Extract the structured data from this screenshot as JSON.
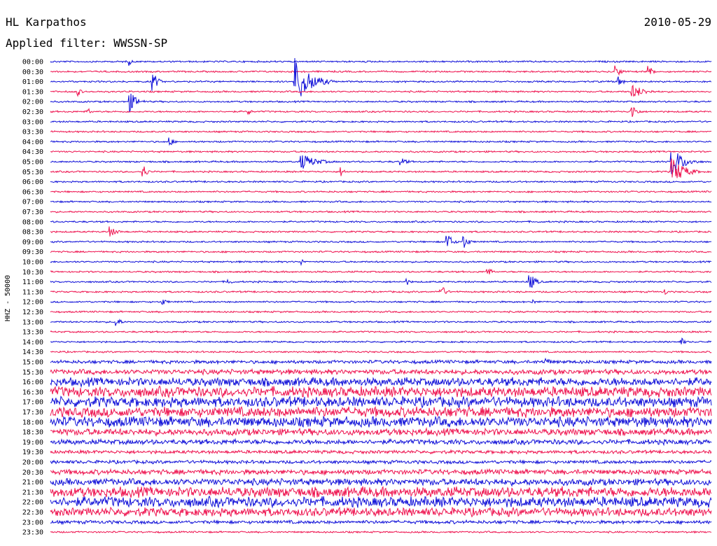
{
  "header": {
    "station": "HL Karpathos",
    "date": "2010-05-29",
    "filter_label": "Applied filter: WWSSN-SP"
  },
  "chart_data": {
    "type": "line",
    "title": "HL Karpathos",
    "ylabel": "HHZ - 50000",
    "colors": [
      "#1010d8",
      "#ee1450"
    ],
    "row_labels": [
      "00:00",
      "00:30",
      "01:00",
      "01:30",
      "02:00",
      "02:30",
      "03:00",
      "03:30",
      "04:00",
      "04:30",
      "05:00",
      "05:30",
      "06:00",
      "06:30",
      "07:00",
      "07:30",
      "08:00",
      "08:30",
      "09:00",
      "09:30",
      "10:00",
      "10:30",
      "11:00",
      "11:30",
      "12:00",
      "12:30",
      "13:00",
      "13:30",
      "14:00",
      "14:30",
      "15:00",
      "15:30",
      "16:00",
      "16:30",
      "17:00",
      "17:30",
      "18:00",
      "18:30",
      "19:00",
      "19:30",
      "20:00",
      "20:30",
      "21:00",
      "21:30",
      "22:00",
      "22:30",
      "23:00",
      "23:30"
    ],
    "noise_level": [
      1,
      1,
      1,
      1,
      1,
      1,
      1,
      1,
      1,
      1,
      1,
      1,
      1,
      1,
      1,
      1,
      1,
      1,
      1,
      1,
      1,
      1,
      1,
      1,
      1,
      1,
      1,
      1,
      1,
      1,
      2,
      3,
      5,
      6,
      6,
      6,
      6,
      4,
      3,
      2,
      2,
      3,
      4,
      6,
      6,
      5,
      2,
      1
    ],
    "events": [
      {
        "row": 0,
        "x": 0.12,
        "amp": 1,
        "dur": 0.01
      },
      {
        "row": 1,
        "x": 0.855,
        "amp": 1.6,
        "dur": 0.02
      },
      {
        "row": 1,
        "x": 0.905,
        "amp": 1.5,
        "dur": 0.02
      },
      {
        "row": 2,
        "x": 0.155,
        "amp": 2.5,
        "dur": 0.02
      },
      {
        "row": 2,
        "x": 0.37,
        "amp": 6,
        "dur": 0.06
      },
      {
        "row": 2,
        "x": 0.86,
        "amp": 1.5,
        "dur": 0.02
      },
      {
        "row": 3,
        "x": 0.04,
        "amp": 1.5,
        "dur": 0.015
      },
      {
        "row": 3,
        "x": 0.88,
        "amp": 1.8,
        "dur": 0.05
      },
      {
        "row": 4,
        "x": 0.12,
        "amp": 2.5,
        "dur": 0.03
      },
      {
        "row": 5,
        "x": 0.058,
        "amp": 1,
        "dur": 0.01
      },
      {
        "row": 5,
        "x": 0.3,
        "amp": 1,
        "dur": 0.01
      },
      {
        "row": 5,
        "x": 0.88,
        "amp": 2,
        "dur": 0.02
      },
      {
        "row": 8,
        "x": 0.18,
        "amp": 1.5,
        "dur": 0.015
      },
      {
        "row": 10,
        "x": 0.38,
        "amp": 2,
        "dur": 0.06
      },
      {
        "row": 10,
        "x": 0.53,
        "amp": 1,
        "dur": 0.03
      },
      {
        "row": 10,
        "x": 0.94,
        "amp": 3.5,
        "dur": 0.05
      },
      {
        "row": 11,
        "x": 0.14,
        "amp": 2.2,
        "dur": 0.015
      },
      {
        "row": 11,
        "x": 0.44,
        "amp": 1.2,
        "dur": 0.015
      },
      {
        "row": 11,
        "x": 0.94,
        "amp": 3.5,
        "dur": 0.05
      },
      {
        "row": 17,
        "x": 0.09,
        "amp": 1.3,
        "dur": 0.03
      },
      {
        "row": 18,
        "x": 0.6,
        "amp": 2.5,
        "dur": 0.02
      },
      {
        "row": 18,
        "x": 0.625,
        "amp": 1.8,
        "dur": 0.02
      },
      {
        "row": 20,
        "x": 0.38,
        "amp": 1,
        "dur": 0.01
      },
      {
        "row": 21,
        "x": 0.66,
        "amp": 1.5,
        "dur": 0.02
      },
      {
        "row": 22,
        "x": 0.27,
        "amp": 0.8,
        "dur": 0.015
      },
      {
        "row": 22,
        "x": 0.54,
        "amp": 0.8,
        "dur": 0.015
      },
      {
        "row": 22,
        "x": 0.725,
        "amp": 2.2,
        "dur": 0.025
      },
      {
        "row": 23,
        "x": 0.59,
        "amp": 2,
        "dur": 0.02
      },
      {
        "row": 23,
        "x": 0.93,
        "amp": 1,
        "dur": 0.01
      },
      {
        "row": 24,
        "x": 0.17,
        "amp": 0.8,
        "dur": 0.02
      },
      {
        "row": 24,
        "x": 0.73,
        "amp": 0.8,
        "dur": 0.01
      },
      {
        "row": 26,
        "x": 0.1,
        "amp": 1.8,
        "dur": 0.015
      },
      {
        "row": 28,
        "x": 0.955,
        "amp": 1,
        "dur": 0.015
      },
      {
        "row": 30,
        "x": 0.75,
        "amp": 1.2,
        "dur": 0.02
      }
    ],
    "grid": false
  }
}
